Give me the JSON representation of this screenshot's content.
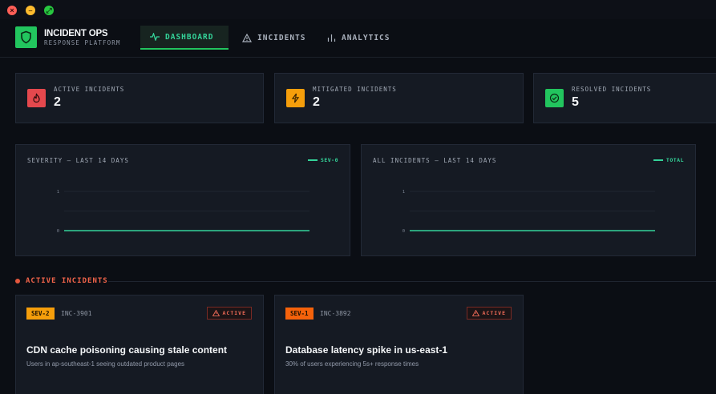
{
  "window": {
    "controls": {
      "close": "×",
      "minimize": "–",
      "maximize": "⤢"
    }
  },
  "brand": {
    "title": "INCIDENT OPS",
    "subtitle": "RESPONSE PLATFORM",
    "icon": "shield-icon",
    "color": "#22c55e"
  },
  "nav": [
    {
      "label": "DASHBOARD",
      "icon": "activity-icon",
      "active": true
    },
    {
      "label": "INCIDENTS",
      "icon": "warning-icon",
      "active": false
    },
    {
      "label": "ANALYTICS",
      "icon": "bar-chart-icon",
      "active": false
    }
  ],
  "stats": [
    {
      "label": "ACTIVE INCIDENTS",
      "value": "2",
      "icon": "flame-icon",
      "color": "#e5484d"
    },
    {
      "label": "MITIGATED INCIDENTS",
      "value": "2",
      "icon": "bolt-icon",
      "color": "#f59e0b"
    },
    {
      "label": "RESOLVED INCIDENTS",
      "value": "5",
      "icon": "check-circle-icon",
      "color": "#22c55e"
    }
  ],
  "charts": [
    {
      "title": "SEVERITY — LAST 14 DAYS",
      "legend": "SEV-0"
    },
    {
      "title": "ALL INCIDENTS — LAST 14 DAYS",
      "legend": "TOTAL"
    }
  ],
  "chart_data": [
    {
      "type": "line",
      "title": "SEVERITY — LAST 14 DAYS",
      "series": [
        {
          "name": "SEV-0",
          "values": [
            0,
            0,
            0,
            0,
            0,
            0,
            0,
            0,
            0,
            0,
            0,
            0,
            0,
            0
          ]
        }
      ],
      "ylim": [
        0,
        1
      ],
      "yticks": [
        "0",
        "1"
      ],
      "grid": true,
      "legend": "top-right",
      "color": "#34d399"
    },
    {
      "type": "line",
      "title": "ALL INCIDENTS — LAST 14 DAYS",
      "series": [
        {
          "name": "TOTAL",
          "values": [
            0,
            0,
            0,
            0,
            0,
            0,
            0,
            0,
            0,
            0,
            0,
            0,
            0,
            0
          ]
        }
      ],
      "ylim": [
        0,
        1
      ],
      "yticks": [
        "0",
        "1"
      ],
      "grid": true,
      "legend": "top-right",
      "color": "#34d399"
    }
  ],
  "section": {
    "label": "ACTIVE INCIDENTS",
    "color": "#f2644a"
  },
  "incidents": [
    {
      "severity": "SEV-2",
      "severity_color": "#f59e0b",
      "id": "INC-3901",
      "status": "ACTIVE",
      "title": "CDN cache poisoning causing stale content",
      "description": "Users in ap-southeast-1 seeing outdated product pages"
    },
    {
      "severity": "SEV-1",
      "severity_color": "#f5620b",
      "id": "INC-3892",
      "status": "ACTIVE",
      "title": "Database latency spike in us-east-1",
      "description": "30% of users experiencing 5s+ response times"
    }
  ]
}
